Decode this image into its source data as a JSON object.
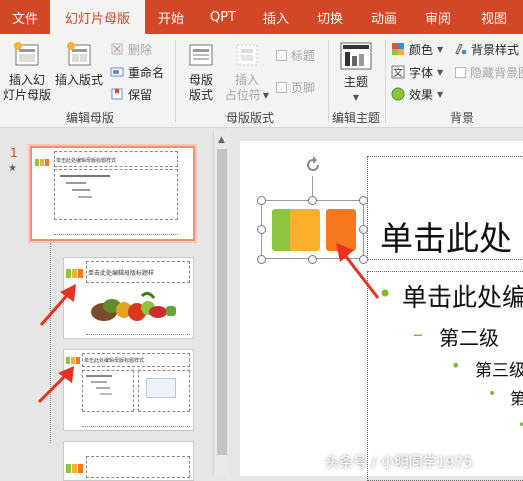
{
  "tabs": [
    {
      "label": "文件",
      "active": false
    },
    {
      "label": "幻灯片母版",
      "active": true
    },
    {
      "label": "开始",
      "active": false
    },
    {
      "label": "QPT",
      "active": false
    },
    {
      "label": "插入",
      "active": false
    },
    {
      "label": "切换",
      "active": false
    },
    {
      "label": "动画",
      "active": false
    },
    {
      "label": "审阅",
      "active": false
    },
    {
      "label": "视图",
      "active": false
    }
  ],
  "ribbon": {
    "edit_master": {
      "insert_master_line1": "插入幻",
      "insert_master_line2": "灯片母版",
      "insert_layout": "插入版式",
      "delete": "删除",
      "rename": "重命名",
      "preserve": "保留",
      "group_label": "编辑母版"
    },
    "master_layout": {
      "master_layout_line1": "母版",
      "master_layout_line2": "版式",
      "insert_placeholder_line1": "插入",
      "insert_placeholder_line2": "占位符",
      "title_chk": "标题",
      "footer_chk": "页脚",
      "group_label": "母版版式"
    },
    "edit_theme": {
      "theme": "主题",
      "group_label": "编辑主题"
    },
    "background": {
      "colors": "颜色",
      "fonts": "字体",
      "effects": "效果",
      "bg_styles": "背景样式",
      "hide_bg": "隐藏背景图",
      "group_label": "背景"
    }
  },
  "thumbnails": {
    "slide_number": "1",
    "star": "★",
    "master_title": "单击此处编辑母版标题样式",
    "layout1_title": "单击此处编辑母版标题样",
    "layout2_title": "单击此处编辑母版标题样式"
  },
  "canvas": {
    "title": "单击此处",
    "level1": "单击此处编",
    "level2": "第二级",
    "level3": "第三级",
    "level4": "第",
    "level1_bullet": "•",
    "level2_bullet": "–",
    "level3_bullet": "•",
    "level4_bullet": "•"
  },
  "colors": {
    "accent": "#d24726",
    "green": "#8cc63e",
    "yellow": "#fbb02d",
    "orange": "#f7781e",
    "arrow": "#e8321f"
  },
  "watermark": "头条号 / 小明同学1975"
}
